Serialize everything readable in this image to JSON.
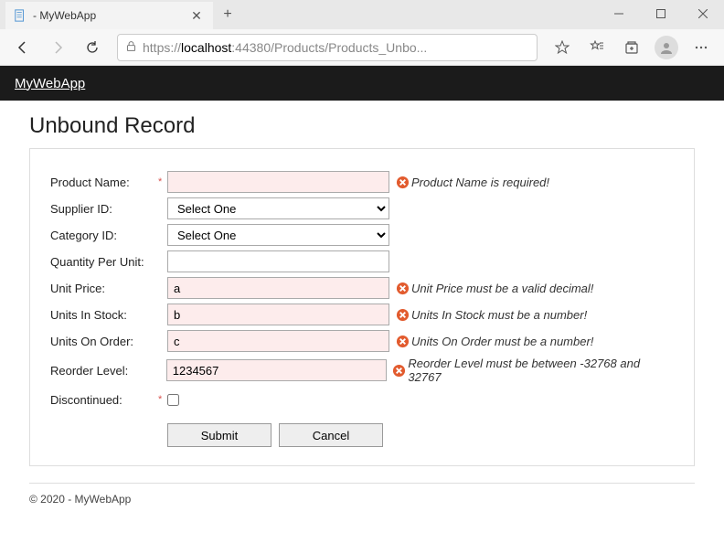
{
  "window": {
    "tab_title": "- MyWebApp",
    "url_prefix": "https://",
    "url_host": "localhost",
    "url_rest": ":44380/Products/Products_Unbo..."
  },
  "header": {
    "brand": "MyWebApp"
  },
  "page": {
    "title": "Unbound Record"
  },
  "form": {
    "product_name": {
      "label": "Product Name:",
      "value": "",
      "error": "Product Name is required!"
    },
    "supplier_id": {
      "label": "Supplier ID:",
      "selected": "Select One"
    },
    "category_id": {
      "label": "Category ID:",
      "selected": "Select One"
    },
    "qty_per_unit": {
      "label": "Quantity Per Unit:",
      "value": ""
    },
    "unit_price": {
      "label": "Unit Price:",
      "value": "a",
      "error": "Unit Price must be a valid decimal!"
    },
    "units_in_stock": {
      "label": "Units In Stock:",
      "value": "b",
      "error": "Units In Stock must be a number!"
    },
    "units_on_order": {
      "label": "Units On Order:",
      "value": "c",
      "error": "Units On Order must be a number!"
    },
    "reorder_level": {
      "label": "Reorder Level:",
      "value": "1234567",
      "error": "Reorder Level must be between -32768 and 32767"
    },
    "discontinued": {
      "label": "Discontinued:"
    },
    "submit_label": "Submit",
    "cancel_label": "Cancel"
  },
  "footer": {
    "text": "© 2020 - MyWebApp"
  }
}
